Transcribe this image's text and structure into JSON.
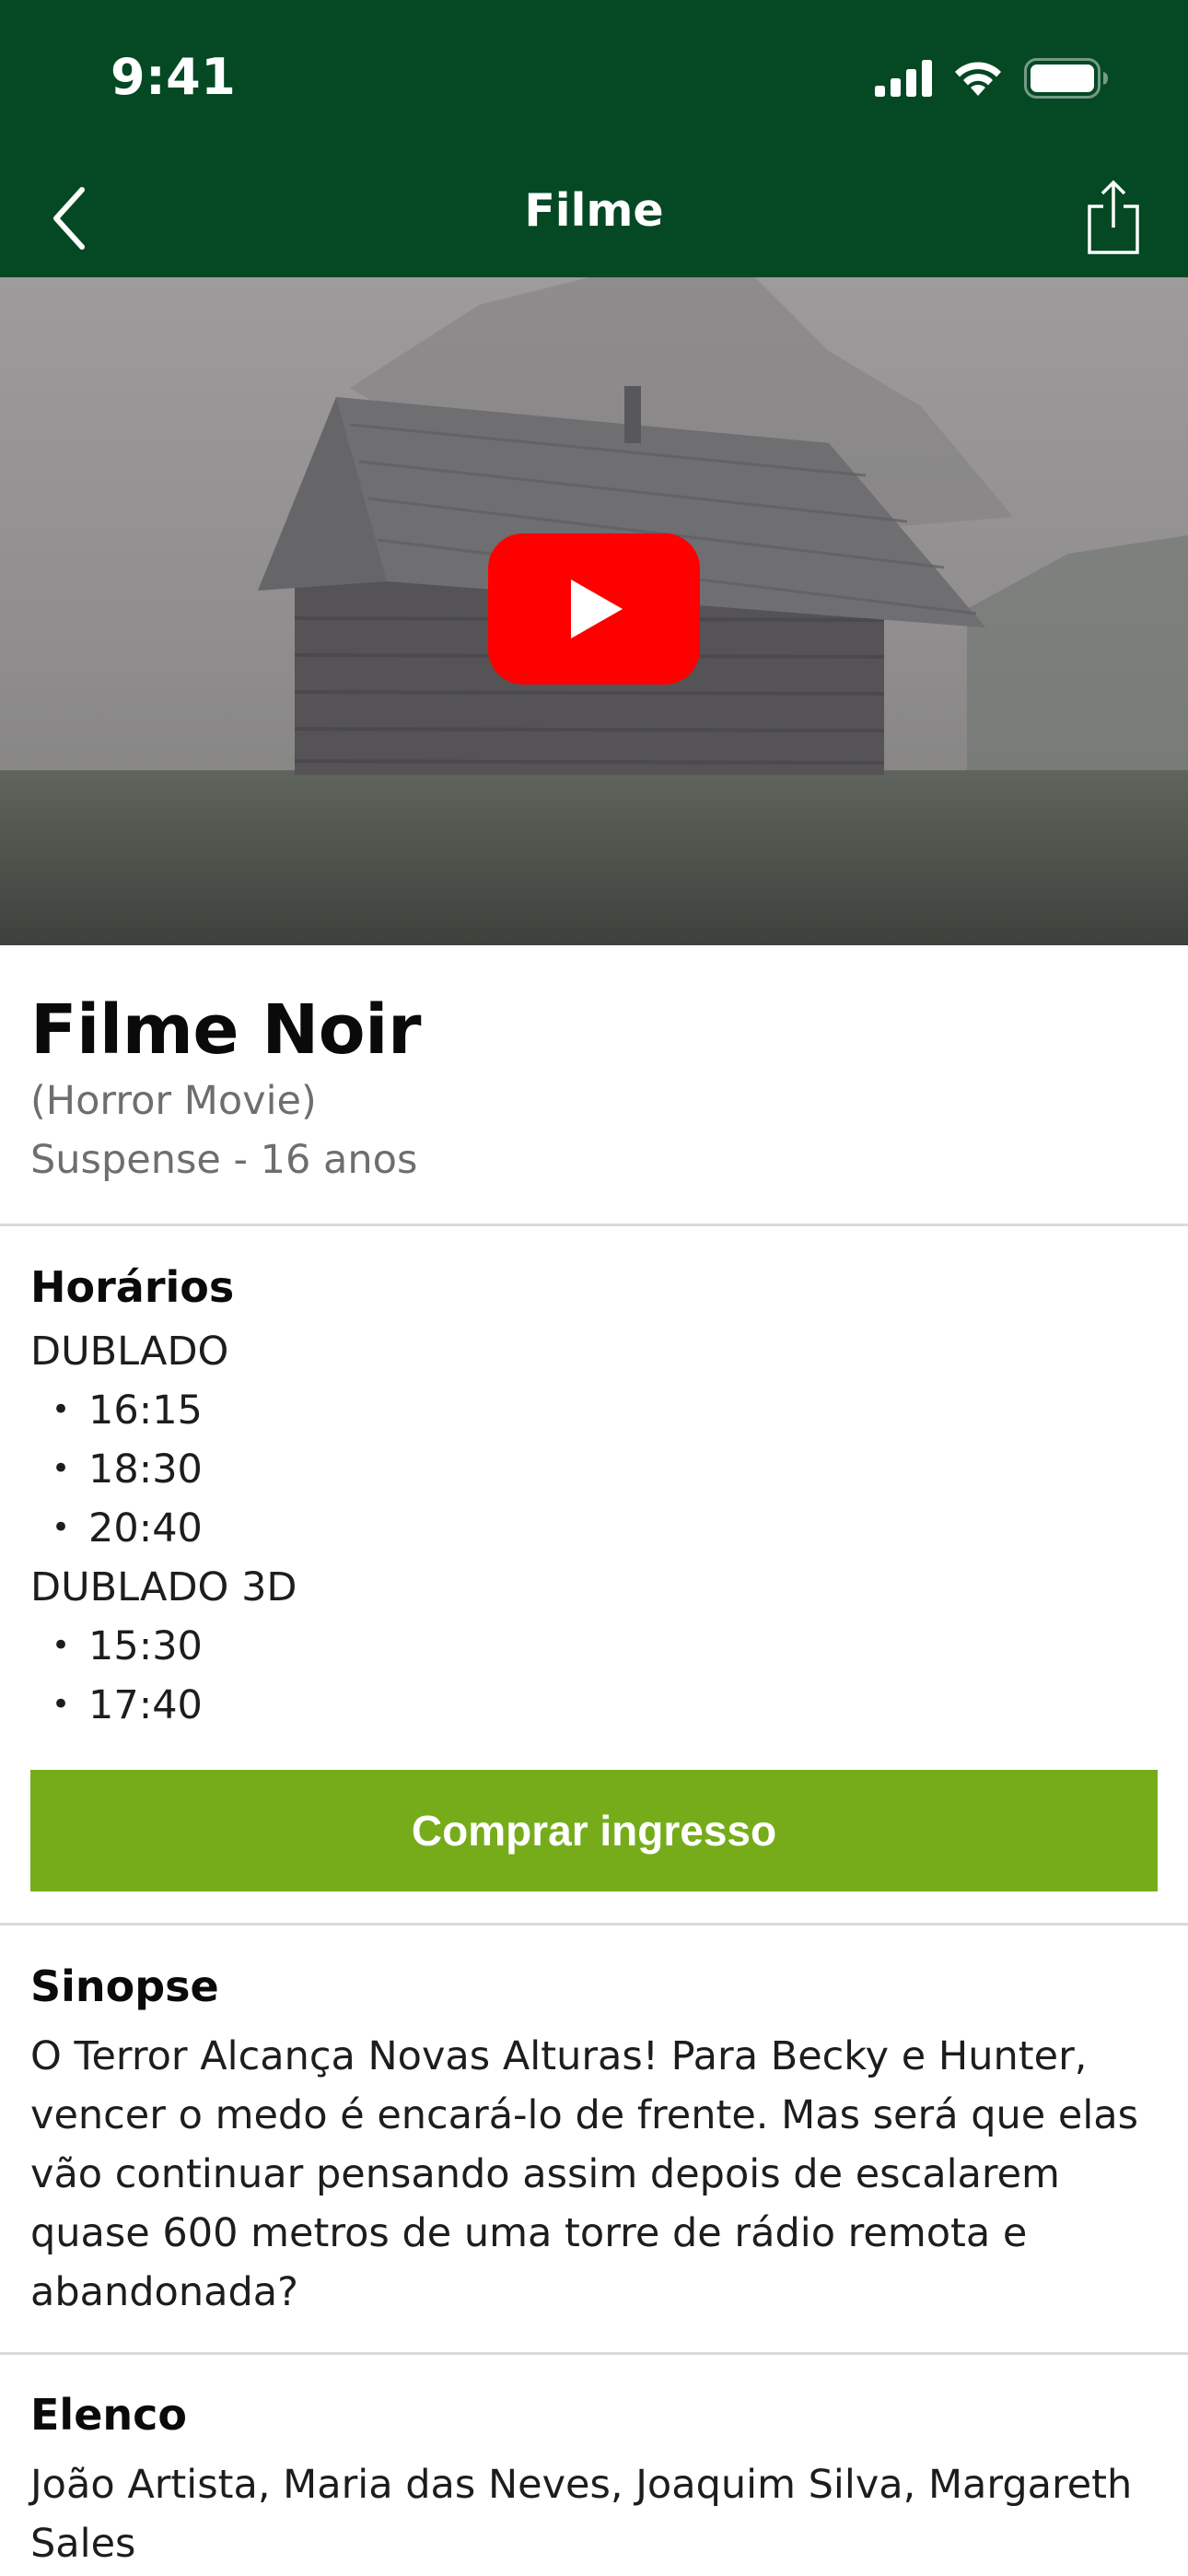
{
  "status_bar": {
    "time": "9:41",
    "icons": [
      "signal-icon",
      "wifi-icon",
      "battery-icon"
    ]
  },
  "nav": {
    "title": "Filme",
    "back_icon": "chevron-left-icon",
    "share_icon": "share-icon"
  },
  "video": {
    "play_icon": "youtube-play-icon",
    "play_color": "#FF0000"
  },
  "movie": {
    "title": "Filme Noir",
    "original_title": "(Horror Movie)",
    "genre_rating": "Suspense - 16 anos"
  },
  "showtimes": {
    "heading": "Horários",
    "groups": [
      {
        "type": "DUBLADO",
        "times": [
          "16:15",
          "18:30",
          "20:40"
        ]
      },
      {
        "type": "DUBLADO 3D",
        "times": [
          "15:30",
          "17:40"
        ]
      }
    ],
    "bullet": "•"
  },
  "buy_button": {
    "label": "Comprar ingresso",
    "color": "#76AC1A"
  },
  "synopsis": {
    "heading": "Sinopse",
    "text": "O Terror Alcança Novas Alturas! Para Becky e Hunter, vencer o medo é encará-lo de frente. Mas será que elas vão continuar pensando assim depois de escalarem quase 600 metros de uma torre de rádio remota e abandonada?"
  },
  "cast": {
    "heading": "Elenco",
    "text": "João Artista, Maria das Neves, Joaquim Silva, Margareth Sales"
  },
  "colors": {
    "header_bg": "#044824",
    "accent_green": "#76AC1A",
    "divider": "#DADADA",
    "secondary_text": "#6E6E6E"
  }
}
